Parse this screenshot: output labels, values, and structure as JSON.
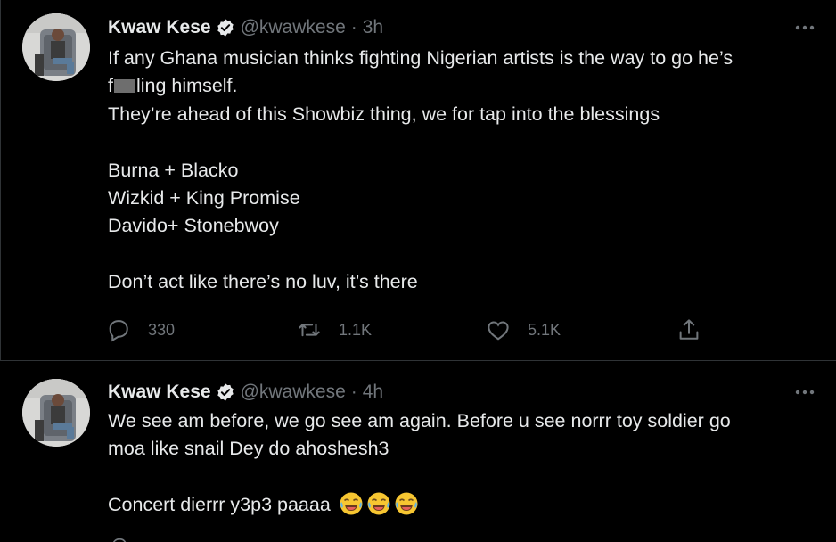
{
  "tweets": [
    {
      "author_name": "Kwaw Kese",
      "handle": "@kwawkese",
      "separator": "·",
      "time": "3h",
      "lines": [
        "If any Ghana musician thinks fighting Nigerian artists is the way to go he’s",
        [
          "f",
          "ling himself."
        ],
        "They’re ahead of this Showbiz thing, we for tap into the blessings",
        "",
        "Burna + Blacko",
        "Wizkid + King Promise",
        "Davido+ Stonebwoy",
        "",
        "Don’t act like there’s no luv, it’s there"
      ],
      "stats": {
        "replies": "330",
        "retweets": "1.1K",
        "likes": "5.1K"
      }
    },
    {
      "author_name": "Kwaw Kese",
      "handle": "@kwawkese",
      "separator": "·",
      "time": "4h",
      "lines": [
        "We see am before, we go see am again. Before u see norrr toy soldier go",
        "moa like snail Dey do ahoshesh3",
        "",
        "Concert dierrr y3p3 paaaa"
      ],
      "emoji": "face-with-tears-of-joy x3"
    }
  ],
  "icons": [
    "verified-badge-icon",
    "more-options-icon",
    "reply-icon",
    "retweet-icon",
    "like-icon",
    "share-icon"
  ],
  "colors": {
    "background": "#000000",
    "text": "#e7e9ea",
    "muted": "#71767b",
    "divider": "#2f3336"
  }
}
